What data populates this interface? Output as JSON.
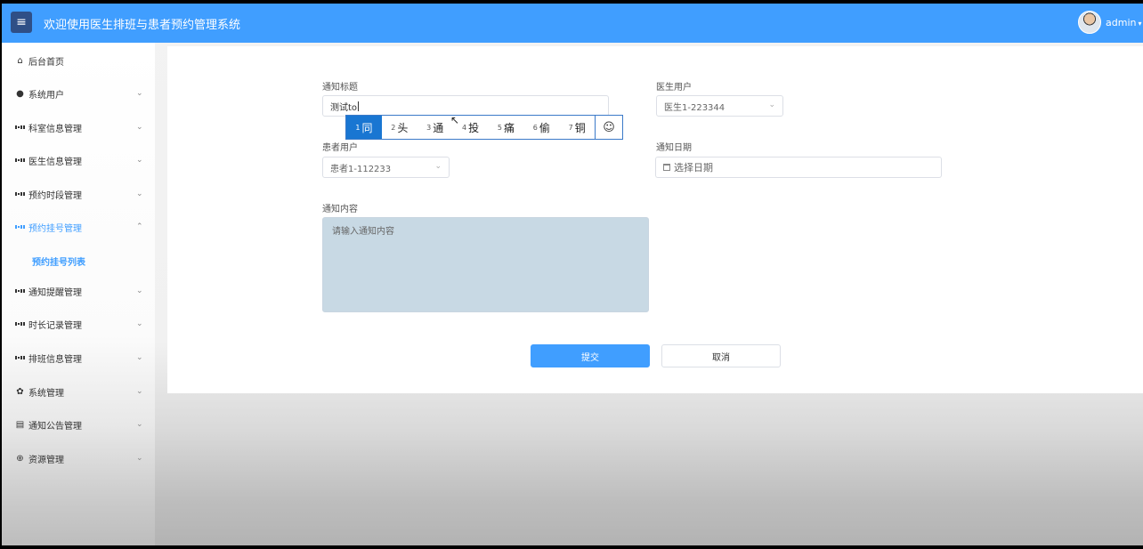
{
  "header": {
    "menu_icon": "hamburger-icon",
    "title": "欢迎使用医生排班与患者预约管理系统",
    "username": "admin",
    "dropdown_icon": "chevron-down-icon"
  },
  "sidebar": {
    "items": [
      {
        "label": "后台首页",
        "icon": "home-icon",
        "expandable": false
      },
      {
        "label": "系统用户",
        "icon": "user-icon",
        "expandable": true
      },
      {
        "label": "科室信息管理",
        "icon": "grid-icon",
        "expandable": true
      },
      {
        "label": "医生信息管理",
        "icon": "grid-icon",
        "expandable": true
      },
      {
        "label": "预约时段管理",
        "icon": "grid-icon",
        "expandable": true
      },
      {
        "label": "预约挂号管理",
        "icon": "grid-icon",
        "expandable": true,
        "expanded": true
      },
      {
        "label": "通知提醒管理",
        "icon": "grid-icon",
        "expandable": true
      },
      {
        "label": "时长记录管理",
        "icon": "grid-icon",
        "expandable": true
      },
      {
        "label": "排班信息管理",
        "icon": "grid-icon",
        "expandable": true
      },
      {
        "label": "系统管理",
        "icon": "gear-icon",
        "expandable": true
      },
      {
        "label": "通知公告管理",
        "icon": "document-icon",
        "expandable": true
      },
      {
        "label": "资源管理",
        "icon": "plus-circle-icon",
        "expandable": true
      }
    ],
    "subitem": "预约挂号列表"
  },
  "form": {
    "title_label": "通知标题",
    "title_value": "测试to",
    "doctor_label": "医生用户",
    "doctor_value": "医生1-223344",
    "patient_label": "患者用户",
    "patient_value": "患者1-112233",
    "date_label": "通知日期",
    "date_placeholder": "选择日期",
    "content_label": "通知内容",
    "content_placeholder": "请输入通知内容",
    "submit": "提交",
    "cancel": "取消"
  },
  "ime": {
    "candidates": [
      {
        "num": "1",
        "text": "同"
      },
      {
        "num": "2",
        "text": "头"
      },
      {
        "num": "3",
        "text": "通"
      },
      {
        "num": "4",
        "text": "投"
      },
      {
        "num": "5",
        "text": "痛"
      },
      {
        "num": "6",
        "text": "偷"
      },
      {
        "num": "7",
        "text": "铜"
      }
    ],
    "emoji": "☺"
  },
  "colors": {
    "accent": "#409eff",
    "ime_selected": "#1976d2",
    "textarea_bg": "#c8d9e4"
  }
}
